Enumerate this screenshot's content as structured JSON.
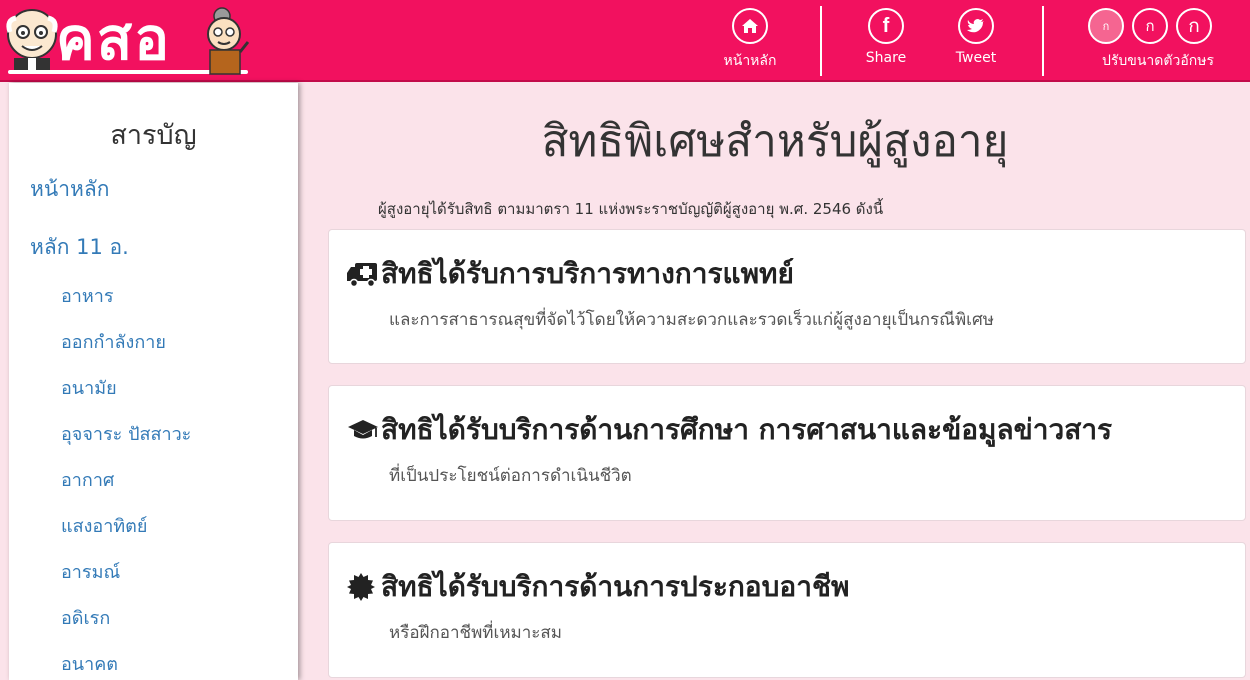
{
  "header": {
    "logo_text": "คสอ",
    "nav": {
      "home_label": "หน้าหลัก",
      "share_label": "Share",
      "tweet_label": "Tweet"
    },
    "font_size": {
      "small": "ก",
      "medium": "ก",
      "large": "ก",
      "label": "ปรับขนาดตัวอักษร"
    }
  },
  "sidebar": {
    "title": "สารบัญ",
    "home": "หน้าหลัก",
    "section": "หลัก 11 อ.",
    "items": [
      "อาหาร",
      "ออกกำลังกาย",
      "อนามัย",
      "อุจจาระ ปัสสาวะ",
      "อากาศ",
      "แสงอาทิตย์",
      "อารมณ์",
      "อดิเรก",
      "อนาคต"
    ]
  },
  "main": {
    "title": "สิทธิพิเศษสำหรับผู้สูงอายุ",
    "intro": "ผู้สูงอายุได้รับสิทธิ ตามมาตรา 11 แห่งพระราชบัญญัติผู้สูงอายุ พ.ศ. 2546 ดังนี้",
    "cards": [
      {
        "icon": "ambulance-icon",
        "title": "สิทธิได้รับการบริการทางการแพทย์",
        "desc": "และการสาธารณสุขที่จัดไว้โดยให้ความสะดวกและรวดเร็วแก่ผู้สูงอายุเป็นกรณีพิเศษ"
      },
      {
        "icon": "graduation-cap-icon",
        "title": "สิทธิได้รับบริการด้านการศึกษา การศาสนาและข้อมูลข่าวสาร",
        "desc": "ที่เป็นประโยชน์ต่อการดำเนินชีวิต"
      },
      {
        "icon": "certificate-icon",
        "title": "สิทธิได้รับบริการด้านการประกอบอาชีพ",
        "desc": "หรือฝึกอาชีพที่เหมาะสม"
      }
    ]
  },
  "colors": {
    "header_bg": "#f2115f",
    "page_bg": "#fbe3ea",
    "link": "#337ab7"
  }
}
